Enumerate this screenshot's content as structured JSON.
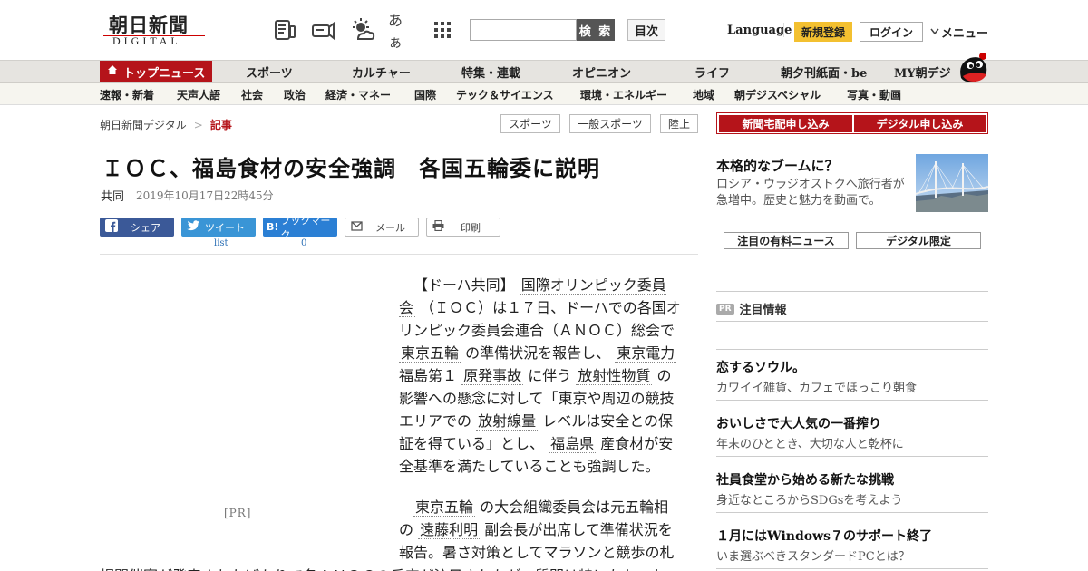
{
  "header": {
    "logo_main": "朝日新聞",
    "logo_sub": "DIGITAL",
    "icons": [
      "paper-icon",
      "megaphone-icon",
      "weather-icon",
      "font-size-icon",
      "grid-icon"
    ],
    "font_icon_label": "あぁ",
    "search_placeholder": "",
    "search_button": "検 索",
    "toc_button": "目次",
    "language": "Language",
    "register": "新規登録",
    "login": "ログイン",
    "menu": "メニュー"
  },
  "nav_primary": [
    {
      "label": "トップニュース",
      "active": true
    },
    {
      "label": "スポーツ"
    },
    {
      "label": "カルチャー"
    },
    {
      "label": "特集・連載"
    },
    {
      "label": "オピニオン"
    },
    {
      "label": "ライフ"
    },
    {
      "label": "朝夕刊紙面・be"
    },
    {
      "label": "MY朝デジ"
    }
  ],
  "nav_secondary": [
    "速報・新着",
    "天声人語",
    "社会",
    "政治",
    "経済・マネー",
    "国際",
    "テック＆サイエンス",
    "環境・エネルギー",
    "地域",
    "朝デジスペシャル",
    "写真・動画"
  ],
  "breadcrumb": {
    "home": "朝日新聞デジタル",
    "sep": ">",
    "current": "記事"
  },
  "tags": [
    "スポーツ",
    "一般スポーツ",
    "陸上"
  ],
  "article": {
    "title": "ＩＯＣ、福島食材の安全強調　各国五輪委に説明",
    "source": "共同",
    "date": "2019年10月17日22時45分",
    "share": {
      "facebook": "シェア",
      "tweet": "ツイート",
      "tweet_count": "list",
      "bookmark": "ブックマーク",
      "bookmark_count": "0",
      "mail": "メール",
      "print": "印刷"
    },
    "ad_label": "[PR]",
    "p1": {
      "t1": "【ドーハ共同】",
      "l1": "国際オリンピック委員会",
      "t2": "（ＩＯＣ）は１７日、ドーハでの各国オリンピック委員会連合（ＡＮＯＣ）総会で",
      "l2": "東京五輪",
      "t3": "の準備状況を報告し、",
      "l3": "東京電力",
      "t4": "福島第１",
      "l4": "原発事故",
      "t5": "に伴う",
      "l5": "放射性物質",
      "t6": "の影響への懸念に対して「東京や周辺の競技エリアでの",
      "l6": "放射線量",
      "t7": "レベルは安全との保証を得ている」とし、",
      "l7": "福島県",
      "t8": "産食材が安全基準を満たしていることも強調した。"
    },
    "p2": {
      "l1": "東京五輪",
      "t1": "の大会組織委員会は元五輪相の",
      "l2": "遠藤利明",
      "t2": "副会長が出席して準備状況を報告。暑さ対策としてマラソンと競歩の札"
    },
    "overflow_line": "幌開催案が発表されたばかりで各ＡＮＯＣの反応が注目されたが、質問は特になかった。"
  },
  "sidebar": {
    "subscribe_paper": "新聞宅配申し込み",
    "subscribe_digital": "デジタル申し込み",
    "promo_title": "本格的なブームに？",
    "promo_desc": "ロシア・ウラジオストクへ旅行者が急増中。歴史と魅力を動画で。",
    "tab_paid": "注目の有料ニュース",
    "tab_digital": "デジタル限定",
    "pr_badge": "PR",
    "pr_heading": "注目情報",
    "pr_items": [
      {
        "title": "恋するソウル。",
        "desc": "カワイイ雑貨、カフェでほっこり朝食"
      },
      {
        "title": "おいしさで大人気の一番搾り",
        "desc": "年末のひととき、大切な人と乾杯に"
      },
      {
        "title": "社員食堂から始める新たな挑戦",
        "desc": "身近なところからSDGsを考えよう"
      },
      {
        "title": "１月にはWindows７のサポート終了",
        "desc": "いま選ぶべきスタンダードPCとは？"
      }
    ]
  },
  "colors": {
    "brand_red": "#b5141a",
    "register_yellow": "#f3c030",
    "facebook": "#3b5998",
    "twitter": "#3a95d6",
    "hatena": "#2b7fd4"
  }
}
